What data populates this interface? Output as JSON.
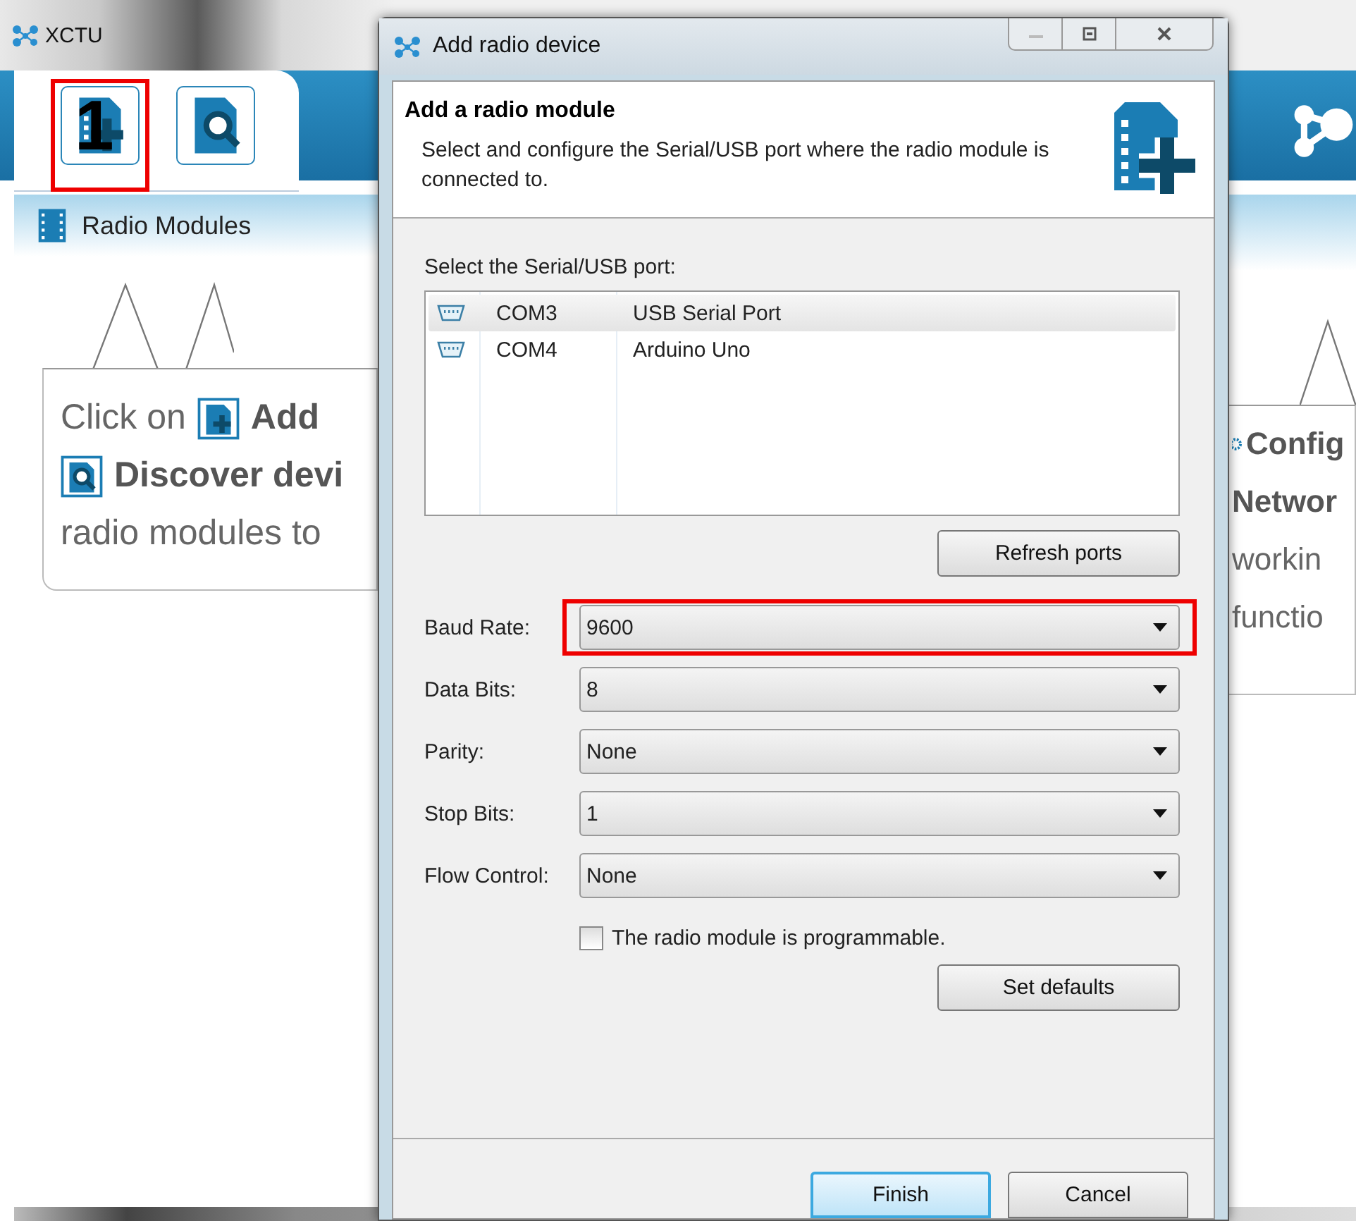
{
  "app": {
    "title": "XCTU",
    "toolbar": [
      {
        "kind": "add",
        "highlighted": true,
        "step": "1"
      },
      {
        "kind": "discover",
        "highlighted": false
      }
    ],
    "panel": {
      "title": "Radio Modules",
      "hint_lines": [
        {
          "segments": [
            {
              "kind": "text",
              "text": "Click on"
            },
            {
              "kind": "add_icon"
            },
            {
              "kind": "bold",
              "text": "Add"
            }
          ]
        },
        {
          "segments": [
            {
              "kind": "discover_icon"
            },
            {
              "kind": "bold",
              "text": "Discover devi"
            }
          ]
        },
        {
          "segments": [
            {
              "kind": "text",
              "text": "radio modules to"
            }
          ]
        }
      ]
    },
    "right_panel": {
      "hint_lines": [
        {
          "segments": [
            {
              "kind": "gear_icon"
            },
            {
              "kind": "bold",
              "text": "Config"
            }
          ]
        },
        {
          "segments": [
            {
              "kind": "bold",
              "text": "Networ"
            }
          ]
        },
        {
          "segments": [
            {
              "kind": "text",
              "text": "workin"
            }
          ]
        },
        {
          "segments": [
            {
              "kind": "text",
              "text": "functio"
            }
          ]
        }
      ]
    }
  },
  "dialog": {
    "title": "Add radio device",
    "header": {
      "title": "Add a radio module",
      "description": "Select and configure the Serial/USB port where the radio module is connected to."
    },
    "port_label": "Select the Serial/USB port:",
    "ports": [
      {
        "name": "COM3",
        "description": "USB Serial Port",
        "selected": true
      },
      {
        "name": "COM4",
        "description": "Arduino Uno",
        "selected": false
      }
    ],
    "refresh_button": "Refresh ports",
    "fields": [
      {
        "label": "Baud Rate:",
        "value": "9600",
        "highlighted": true
      },
      {
        "label": "Data Bits:",
        "value": "8",
        "highlighted": false
      },
      {
        "label": "Parity:",
        "value": "None",
        "highlighted": false
      },
      {
        "label": "Stop Bits:",
        "value": "1",
        "highlighted": false
      },
      {
        "label": "Flow Control:",
        "value": "None",
        "highlighted": false
      }
    ],
    "programmable": {
      "label": "The radio module is programmable.",
      "checked": false
    },
    "defaults_button": "Set defaults",
    "buttons": [
      {
        "label": "Finish",
        "default": true
      },
      {
        "label": "Cancel",
        "default": false
      }
    ]
  }
}
